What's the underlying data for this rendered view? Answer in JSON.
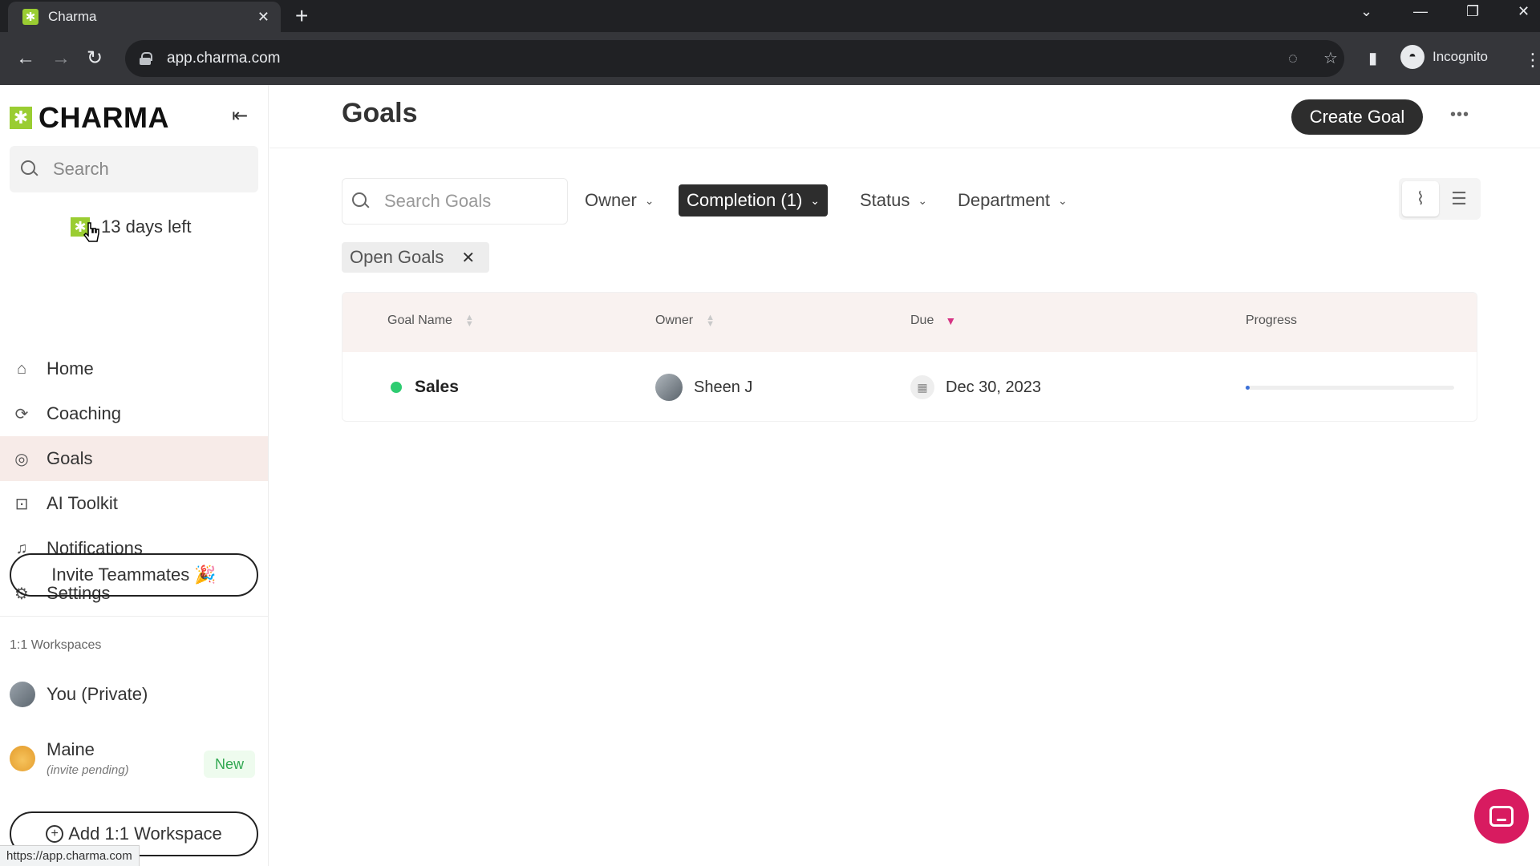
{
  "browser": {
    "tab_title": "Charma",
    "tab_close": "✕",
    "new_tab": "+",
    "url": "app.charma.com",
    "profile_label": "Incognito",
    "status_url": "https://app.charma.com"
  },
  "sidebar": {
    "logo_text": "CHARMA",
    "search_placeholder": "Search",
    "trial_text": "13 days left",
    "nav": [
      {
        "label": "Home",
        "icon": "home-icon"
      },
      {
        "label": "Coaching",
        "icon": "coaching-icon"
      },
      {
        "label": "Goals",
        "icon": "target-icon",
        "active": true
      },
      {
        "label": "AI Toolkit",
        "icon": "robot-icon"
      },
      {
        "label": "Notifications",
        "icon": "bell-icon"
      },
      {
        "label": "Settings",
        "icon": "gear-icon"
      }
    ],
    "invite_label": "Invite Teammates 🎉",
    "workspaces_title": "1:1 Workspaces",
    "workspaces": [
      {
        "name": "You (Private)"
      },
      {
        "name": "Maine",
        "subtitle": "(invite pending)",
        "badge": "New"
      }
    ],
    "add_workspace_label": "Add 1:1 Workspace"
  },
  "main": {
    "title": "Goals",
    "create_label": "Create Goal",
    "more_label": "•••",
    "search_placeholder": "Search Goals",
    "filters": [
      {
        "label": "Owner",
        "active": false
      },
      {
        "label": "Completion (1)",
        "active": true
      },
      {
        "label": "Status",
        "active": false
      },
      {
        "label": "Department",
        "active": false
      }
    ],
    "active_chip": "Open Goals",
    "table": {
      "columns": [
        "Goal Name",
        "Owner",
        "Due",
        "Progress"
      ],
      "rows": [
        {
          "goal": "Sales",
          "status_color": "#2ecc71",
          "owner": "Sheen J",
          "due": "Dec 30, 2023",
          "progress": 0.02
        }
      ]
    }
  },
  "colors": {
    "accent": "#9acd32",
    "active_nav": "#f7ebe8",
    "primary_button": "#2d2d2d",
    "chat_button": "#d81b60",
    "sort_active": "#d63384"
  }
}
